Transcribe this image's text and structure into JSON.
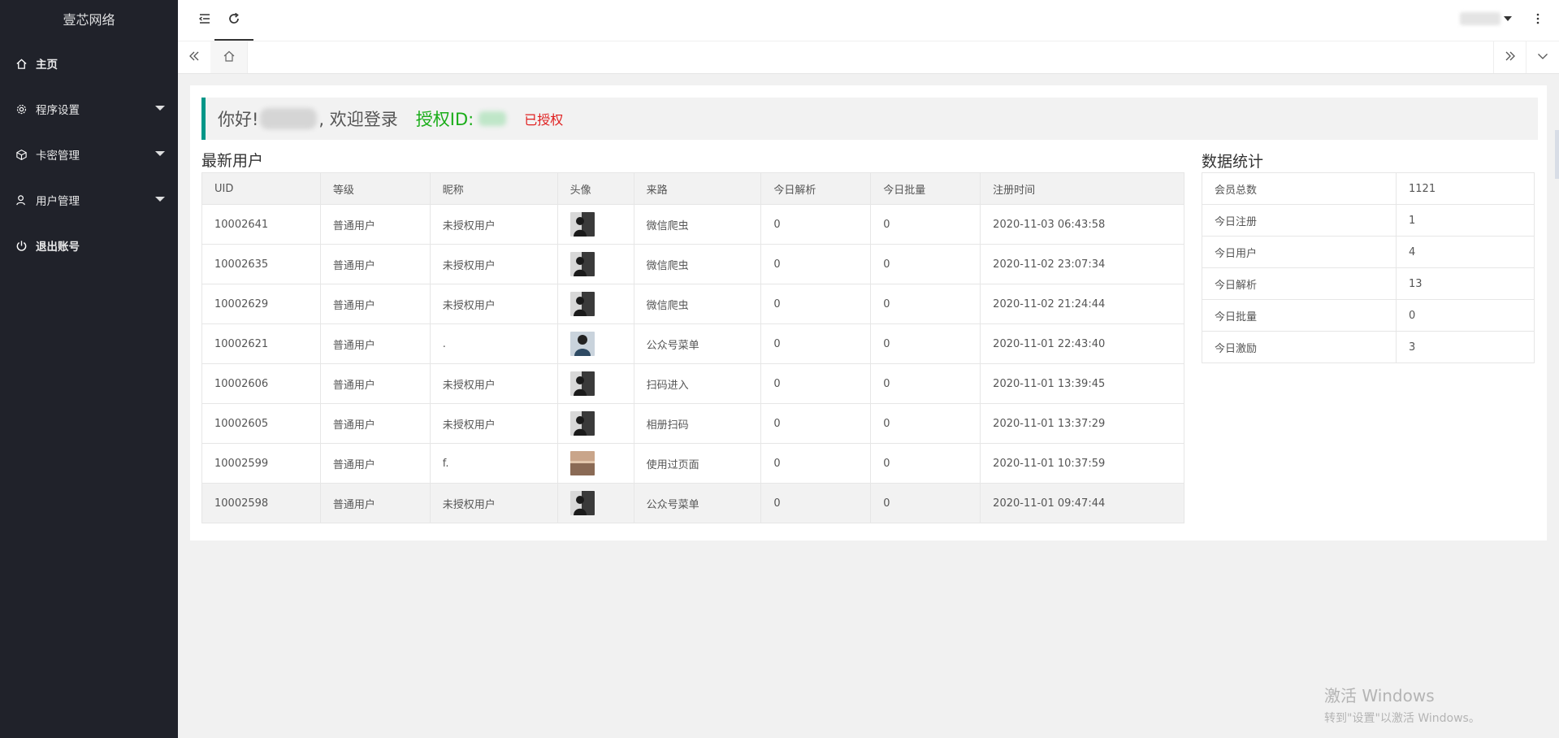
{
  "sidebar": {
    "logo": "壹芯网络",
    "items": [
      {
        "label": "主页",
        "icon": "home-icon"
      },
      {
        "label": "程序设置",
        "icon": "gear-icon"
      },
      {
        "label": "卡密管理",
        "icon": "box-icon"
      },
      {
        "label": "用户管理",
        "icon": "user-icon"
      },
      {
        "label": "退出账号",
        "icon": "power-icon"
      }
    ]
  },
  "header": {
    "icons": [
      "shrink-menu-icon",
      "refresh-icon",
      "more-icon"
    ]
  },
  "welcome": {
    "greeting": "你好!",
    "welcome_text": ", 欢迎登录",
    "license_label": "授权ID:",
    "status": "已授权"
  },
  "users": {
    "title": "最新用户",
    "columns": [
      "UID",
      "等级",
      "昵称",
      "头像",
      "来路",
      "今日解析",
      "今日批量",
      "注册时间"
    ],
    "rows": [
      {
        "uid": "10002641",
        "level": "普通用户",
        "nickname": "未授权用户",
        "source": "微信爬虫",
        "parse": "0",
        "batch": "0",
        "time": "2020-11-03 06:43:58"
      },
      {
        "uid": "10002635",
        "level": "普通用户",
        "nickname": "未授权用户",
        "source": "微信爬虫",
        "parse": "0",
        "batch": "0",
        "time": "2020-11-02 23:07:34"
      },
      {
        "uid": "10002629",
        "level": "普通用户",
        "nickname": "未授权用户",
        "source": "微信爬虫",
        "parse": "0",
        "batch": "0",
        "time": "2020-11-02 21:24:44"
      },
      {
        "uid": "10002621",
        "level": "普通用户",
        "nickname": ".",
        "source": "公众号菜单",
        "parse": "0",
        "batch": "0",
        "time": "2020-11-01 22:43:40"
      },
      {
        "uid": "10002606",
        "level": "普通用户",
        "nickname": "未授权用户",
        "source": "扫码进入",
        "parse": "0",
        "batch": "0",
        "time": "2020-11-01 13:39:45"
      },
      {
        "uid": "10002605",
        "level": "普通用户",
        "nickname": "未授权用户",
        "source": "相册扫码",
        "parse": "0",
        "batch": "0",
        "time": "2020-11-01 13:37:29"
      },
      {
        "uid": "10002599",
        "level": "普通用户",
        "nickname": "f.",
        "source": "使用过页面",
        "parse": "0",
        "batch": "0",
        "time": "2020-11-01 10:37:59"
      },
      {
        "uid": "10002598",
        "level": "普通用户",
        "nickname": "未授权用户",
        "source": "公众号菜单",
        "parse": "0",
        "batch": "0",
        "time": "2020-11-01 09:47:44"
      }
    ]
  },
  "stats": {
    "title": "数据统计",
    "rows": [
      {
        "label": "会员总数",
        "value": "1121"
      },
      {
        "label": "今日注册",
        "value": "1"
      },
      {
        "label": "今日用户",
        "value": "4"
      },
      {
        "label": "今日解析",
        "value": "13"
      },
      {
        "label": "今日批量",
        "value": "0"
      },
      {
        "label": "今日激励",
        "value": "3"
      }
    ]
  },
  "watermark": {
    "line1": "激活 Windows",
    "line2": "转到\"设置\"以激活 Windows。"
  },
  "colors": {
    "sidebar_bg": "#20222a",
    "accent": "#009688",
    "license_green": "#1aad19",
    "status_red": "#e02020"
  }
}
